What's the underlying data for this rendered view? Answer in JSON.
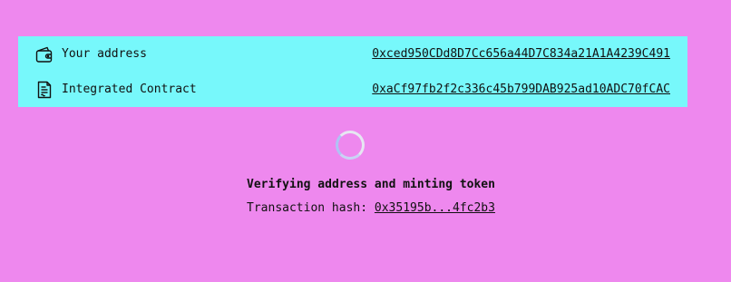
{
  "info": {
    "address_label": "Your address",
    "address_value": "0xced950CDd8D7Cc656a44D7C834a21A1A4239C491",
    "address_icon": "wallet-icon",
    "contract_label": "Integrated Contract",
    "contract_value": "0xaCf97fb2f2c336c45b799DAB925ad10ADC70fCAC",
    "contract_icon": "document-icon"
  },
  "status": {
    "message": "Verifying address and minting token",
    "tx_label": "Transaction hash:",
    "tx_hash": "0x35195b...4fc2b3"
  },
  "colors": {
    "background": "#EE88EE",
    "panel": "#77F8FB"
  }
}
